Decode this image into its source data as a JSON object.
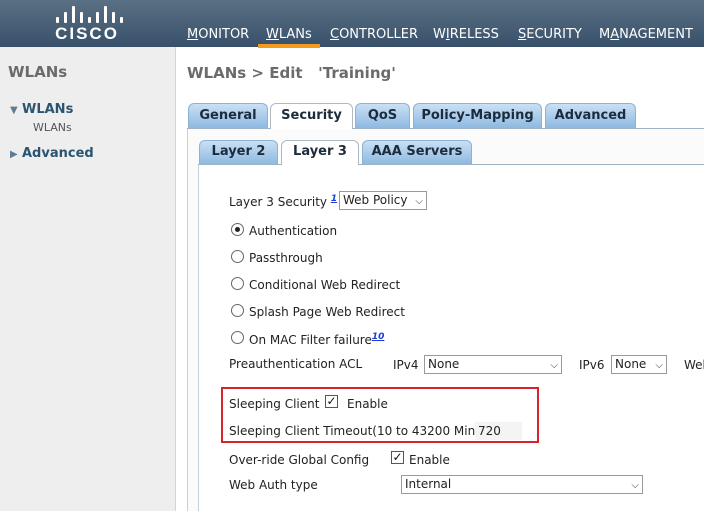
{
  "brand": {
    "logo_text": "CISCO"
  },
  "nav": [
    {
      "label": "MONITOR",
      "key": "M"
    },
    {
      "label": "WLANs",
      "key": "W"
    },
    {
      "label": "CONTROLLER",
      "key": "C"
    },
    {
      "label": "WIRELESS",
      "key": "I"
    },
    {
      "label": "SECURITY",
      "key": "S"
    },
    {
      "label": "MANAGEMENT",
      "key": "A"
    }
  ],
  "sidebar": {
    "title": "WLANs",
    "items": [
      {
        "label": "WLANs",
        "expanded": true,
        "sub": "WLANs"
      },
      {
        "label": "Advanced",
        "expanded": false
      }
    ]
  },
  "page": {
    "title": "WLANs > Edit   'Training'"
  },
  "tabs": [
    "General",
    "Security",
    "QoS",
    "Policy-Mapping",
    "Advanced"
  ],
  "active_tab": "Security",
  "subtabs": [
    "Layer 2",
    "Layer 3",
    "AAA Servers"
  ],
  "active_subtab": "Layer 3",
  "form": {
    "l3_security_label": "Layer 3 Security",
    "l3_security_footnote": "1",
    "l3_security_value": "Web Policy",
    "radios": [
      {
        "label": "Authentication",
        "checked": true
      },
      {
        "label": "Passthrough",
        "checked": false
      },
      {
        "label": "Conditional Web Redirect",
        "checked": false
      },
      {
        "label": "Splash Page Web Redirect",
        "checked": false
      },
      {
        "label": "On MAC Filter failure",
        "checked": false,
        "footnote": "10"
      }
    ],
    "preauth_label": "Preauthentication ACL",
    "ipv4_label": "IPv4",
    "ipv4_value": "None",
    "ipv6_label": "IPv6",
    "ipv6_value": "None",
    "web_label_partial": "Web",
    "sleeping_client_label": "Sleeping Client",
    "sleeping_client_enable": "Enable",
    "sleeping_timeout_label": "Sleeping Client Timeout(10 to 43200 Min)",
    "sleeping_timeout_value": "720",
    "override_label": "Over-ride Global Config",
    "override_enable": "Enable",
    "web_auth_type_label": "Web Auth type",
    "web_auth_type_value": "Internal"
  },
  "colors": {
    "topbar": "#38506a",
    "active_nav_underline": "#f39b1e",
    "tab_blue": "#8eb9e0",
    "highlight_border": "#d9232a",
    "footnote_link": "#1a3bd6"
  }
}
